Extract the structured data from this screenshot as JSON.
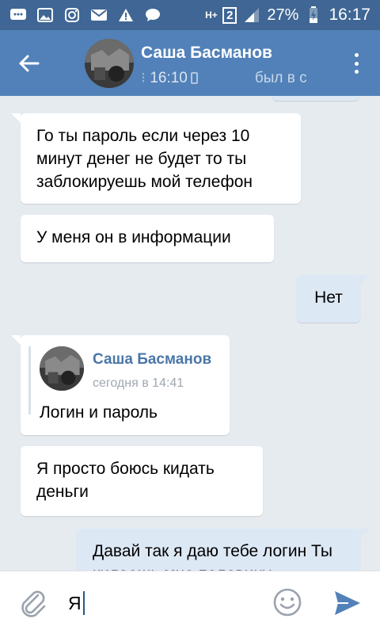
{
  "status_bar": {
    "network": "H+",
    "sim": "2",
    "battery": "27%",
    "time": "16:17"
  },
  "header": {
    "contact_name": "Саша Басманов",
    "online_time": "16:10",
    "last_seen": "был в с"
  },
  "messages": [
    {
      "direction": "in",
      "text": "Го ты пароль если через 10 минут денег не будет то ты заблокируешь мой телефон"
    },
    {
      "direction": "in",
      "text": "У меня он в информации"
    },
    {
      "direction": "out",
      "text": "Нет"
    },
    {
      "direction": "in",
      "forwarded": {
        "author": "Саша Басманов",
        "time": "сегодня в 14:41",
        "text": "Логин и пароль"
      }
    },
    {
      "direction": "in",
      "text": "Я просто боюсь кидать деньги"
    },
    {
      "direction": "out",
      "text": "Давай так я даю тебе логин Ты кидаешь мне половину"
    }
  ],
  "composer": {
    "input_value": "Я"
  },
  "colors": {
    "status_bar": "#3f6694",
    "header": "#5181b8",
    "chat_bg": "#e6ebf0",
    "outgoing_bubble": "#dde8f5",
    "accent": "#4a76a8"
  },
  "icons": {
    "back": "arrow-left-icon",
    "menu": "more-vertical-icon",
    "attach": "paperclip-icon",
    "emoji": "smiley-icon",
    "send": "send-icon"
  }
}
